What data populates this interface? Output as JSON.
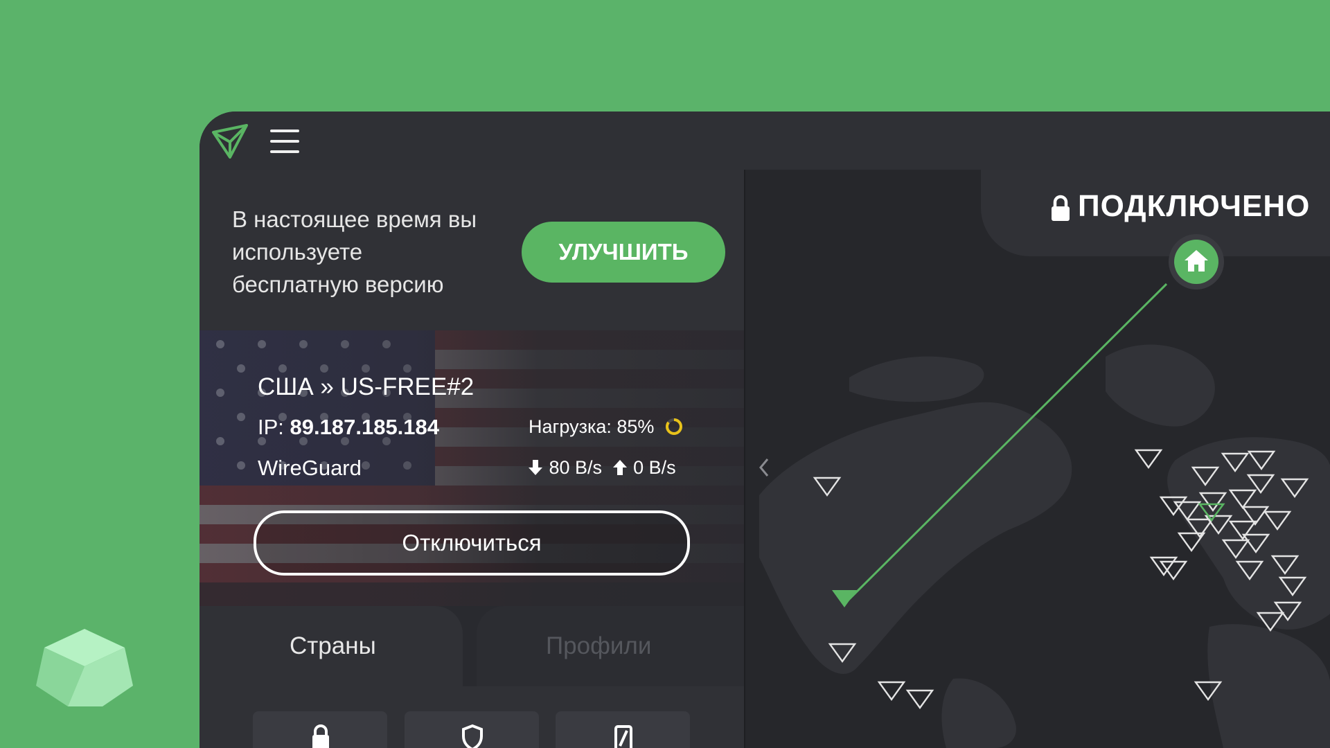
{
  "app": {
    "upgrade_banner": {
      "text": "В настоящее время вы\nиспользуете\nбесплатную версию",
      "button_label": "УЛУЧШИТЬ"
    },
    "connection": {
      "server": "США » US-FREE#2",
      "ip_label": "IP:",
      "ip_value": "89.187.185.184",
      "load_label": "Нагрузка: 85%",
      "load_percent": 85,
      "protocol": "WireGuard",
      "download": "80 B/s",
      "upload": "0 B/s",
      "disconnect_label": "Отключиться"
    },
    "tabs": [
      {
        "label": "Страны",
        "active": true
      },
      {
        "label": "Профили",
        "active": false
      }
    ],
    "map": {
      "status": "ПОДКЛЮЧЕНО"
    }
  },
  "colors": {
    "accent": "#5ab563",
    "background": "#5bb36a",
    "panel": "#292a2f"
  },
  "icons": [
    "vpn-logo-icon",
    "menu-icon",
    "home-icon",
    "lock-icon",
    "shield-icon",
    "tor-icon",
    "arrow-down-icon",
    "arrow-up-icon",
    "chevron-left-icon"
  ]
}
